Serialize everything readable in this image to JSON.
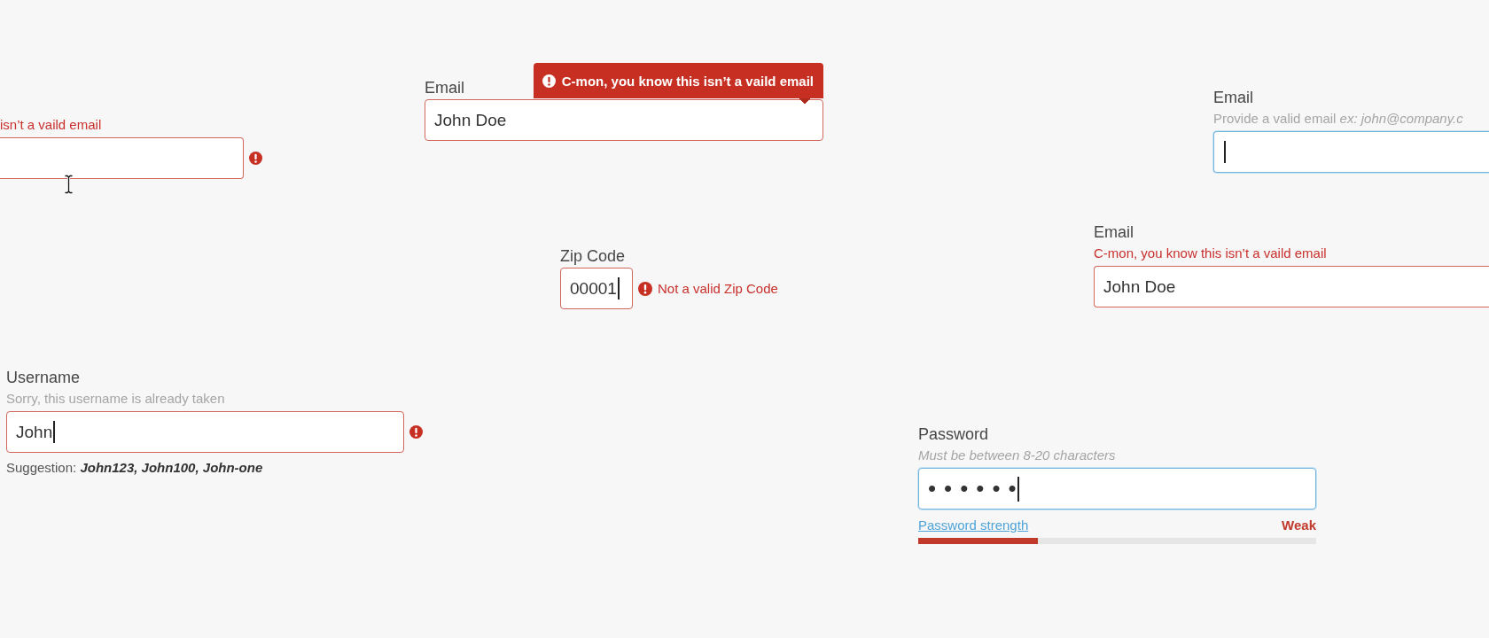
{
  "fields": [
    {
      "kind": "message-above",
      "invalid": true,
      "focused": false,
      "message": "isn’t a vaild email",
      "caret": false,
      "alert_icon": true
    },
    {
      "kind": "tooltip",
      "label": "Email",
      "invalid": true,
      "focused": false,
      "message": "C-mon, you know this isn’t a vaild email",
      "value": "John Doe",
      "caret": false,
      "alert_icon": false
    },
    {
      "kind": "hint",
      "label": "Email",
      "hint": "Provide a valid email *ex: john@company.c*",
      "invalid": false,
      "focused": true,
      "caret": true,
      "alert_icon": false
    },
    {
      "kind": "message-beside",
      "label": "Zip Code",
      "invalid": true,
      "focused": false,
      "message": "Not a valid Zip Code",
      "value": "00001",
      "caret": true,
      "alert_icon": false
    },
    {
      "kind": "message-above",
      "label": "Email",
      "invalid": true,
      "focused": false,
      "message": "C-mon, you know this isn’t a vaild email",
      "value": "John Doe",
      "caret": false,
      "alert_icon": false
    },
    {
      "kind": "hint",
      "label": "Username",
      "hint": "Sorry, this username is already taken",
      "invalid": true,
      "focused": false,
      "value": "John",
      "caret": true,
      "alert_icon": true,
      "note": "Suggestion: **John123, John100, John-one**"
    },
    {
      "kind": "password",
      "label": "Password",
      "hint": "Must be between 8-20 characters",
      "invalid": false,
      "focused": true,
      "value": "••••••",
      "caret": true,
      "alert_icon": false,
      "strength": {
        "link": "Password strength",
        "reading": "Weak",
        "level": 0.3
      }
    }
  ]
}
